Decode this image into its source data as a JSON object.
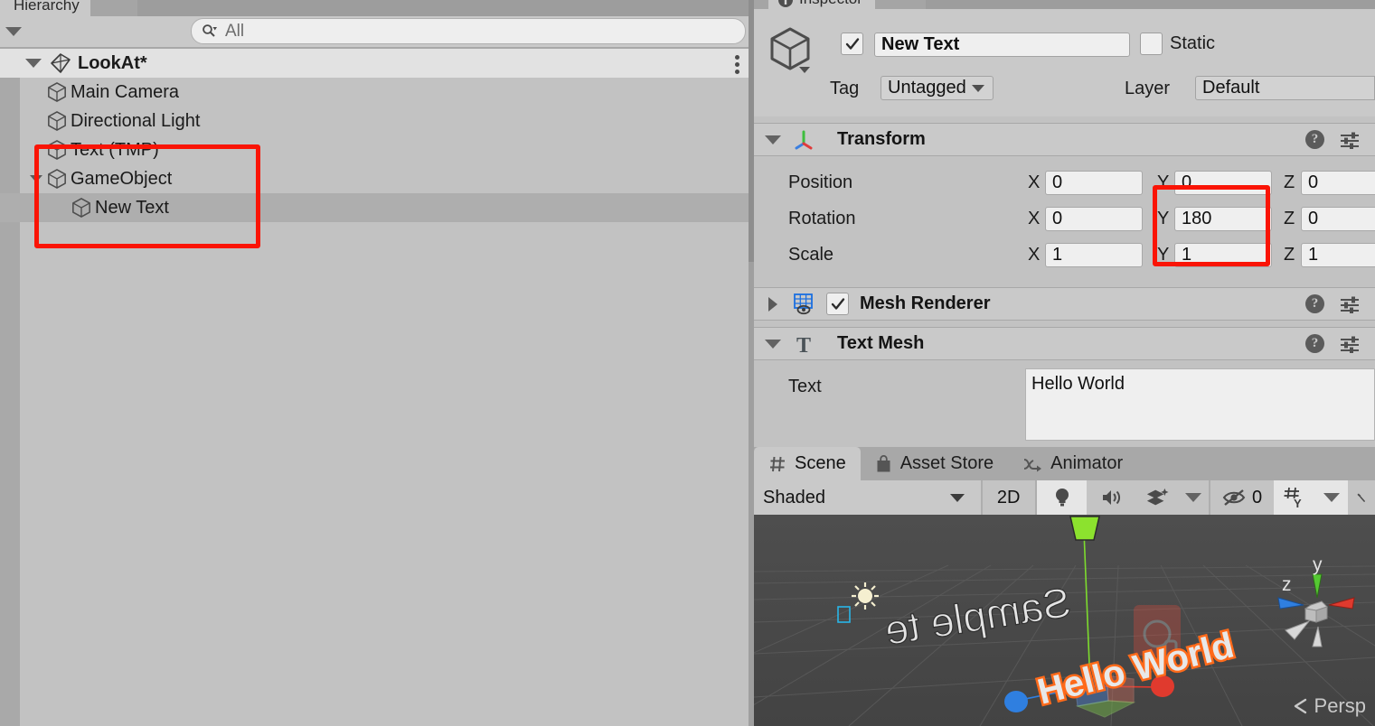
{
  "hierarchy": {
    "tab_label": "Hierarchy",
    "tab_icon": "hierarchy-icon",
    "create_menu_icon": "chevron-down-icon",
    "search": {
      "placeholder": "All",
      "value": "",
      "icon": "search-icon"
    },
    "scene": {
      "name": "LookAt*",
      "icon": "unity-scene-icon",
      "expanded": true,
      "overflow_icon": "kebab-menu-icon"
    },
    "items": [
      {
        "label": "Main Camera",
        "icon": "gameobject-cube-icon",
        "depth": 1,
        "expandable": false,
        "selected": false
      },
      {
        "label": "Directional Light",
        "icon": "gameobject-cube-icon",
        "depth": 1,
        "expandable": false,
        "selected": false
      },
      {
        "label": "Text (TMP)",
        "icon": "gameobject-cube-icon",
        "depth": 1,
        "expandable": false,
        "selected": false
      },
      {
        "label": "GameObject",
        "icon": "gameobject-cube-icon",
        "depth": 1,
        "expandable": true,
        "expanded": true,
        "selected": false
      },
      {
        "label": "New Text",
        "icon": "gameobject-cube-icon",
        "depth": 2,
        "expandable": false,
        "selected": true
      }
    ]
  },
  "inspector": {
    "tab_label": "Inspector",
    "tab_icon": "inspector-icon",
    "object_icon": "gameobject-cube-icon",
    "enabled": true,
    "name": "New Text",
    "static_label": "Static",
    "static_checked": false,
    "tag_label": "Tag",
    "tag_value": "Untagged",
    "layer_label": "Layer",
    "layer_value": "Default",
    "components": [
      {
        "title": "Transform",
        "icon": "transform-axis-icon",
        "expanded": true,
        "has_checkbox": false,
        "help_icon": "help-icon",
        "menu_icon": "component-settings-icon"
      },
      {
        "title": "Mesh Renderer",
        "icon": "mesh-renderer-icon",
        "expanded": false,
        "has_checkbox": true,
        "checked": true,
        "help_icon": "help-icon",
        "menu_icon": "component-settings-icon"
      },
      {
        "title": "Text Mesh",
        "icon": "text-mesh-icon",
        "expanded": true,
        "has_checkbox": false,
        "help_icon": "help-icon",
        "menu_icon": "component-settings-icon"
      }
    ],
    "transform": {
      "rows": [
        {
          "label": "Position",
          "x": "0",
          "y": "0",
          "z": "0"
        },
        {
          "label": "Rotation",
          "x": "0",
          "y": "180",
          "z": "0"
        },
        {
          "label": "Scale",
          "x": "1",
          "y": "1",
          "z": "1"
        }
      ],
      "axis_labels": {
        "x": "X",
        "y": "Y",
        "z": "Z"
      }
    },
    "text_mesh": {
      "text_label": "Text",
      "text_value": "Hello World"
    }
  },
  "scene_panel": {
    "tabs": [
      {
        "label": "Scene",
        "icon": "grid-hash-icon",
        "active": true
      },
      {
        "label": "Asset Store",
        "icon": "shopping-bag-icon",
        "active": false
      },
      {
        "label": "Animator",
        "icon": "animator-icon",
        "active": false
      }
    ],
    "toolbar": {
      "draw_mode": "Shaded",
      "draw_mode_caret_icon": "chevron-down-icon",
      "view_2d_label": "2D",
      "lighting_icon": "lightbulb-icon",
      "lighting_on": true,
      "audio_icon": "speaker-icon",
      "audio_on": false,
      "fx_icon": "effects-layers-icon",
      "fx_caret_icon": "chevron-down-icon",
      "hidden_objects_icon": "eye-off-icon",
      "hidden_objects_count": "0",
      "grid_icon": "grid-y-axis-icon",
      "grid_caret_icon": "chevron-down-icon",
      "tools_icon": "wrench-icon"
    },
    "scene_view": {
      "persp_label": "Persp",
      "persp_caret_icon": "chevron-left-icon",
      "gizmo_axis_labels": {
        "y": "y",
        "z": "z"
      },
      "world_text_flipped": "Sample te",
      "selected_object_text": "Hello World",
      "light_gizmo_icon": "sun-icon",
      "camera_gizmo_icon": "camera-icon"
    }
  },
  "annotations": [
    {
      "name": "hierarchy-selection-highlight",
      "color": "#fa1405"
    },
    {
      "name": "rotation-y-highlight",
      "color": "#fa1405"
    }
  ],
  "colors": {
    "panel_bg": "#c2c2c2",
    "header_bg": "#c9c9c9",
    "tabstrip_bg": "#a5a5a5",
    "selection_row": "#aeaeae",
    "field_bg": "#efefef",
    "scene_bg": "#4b4b4b",
    "annotation_red": "#fa1405"
  }
}
